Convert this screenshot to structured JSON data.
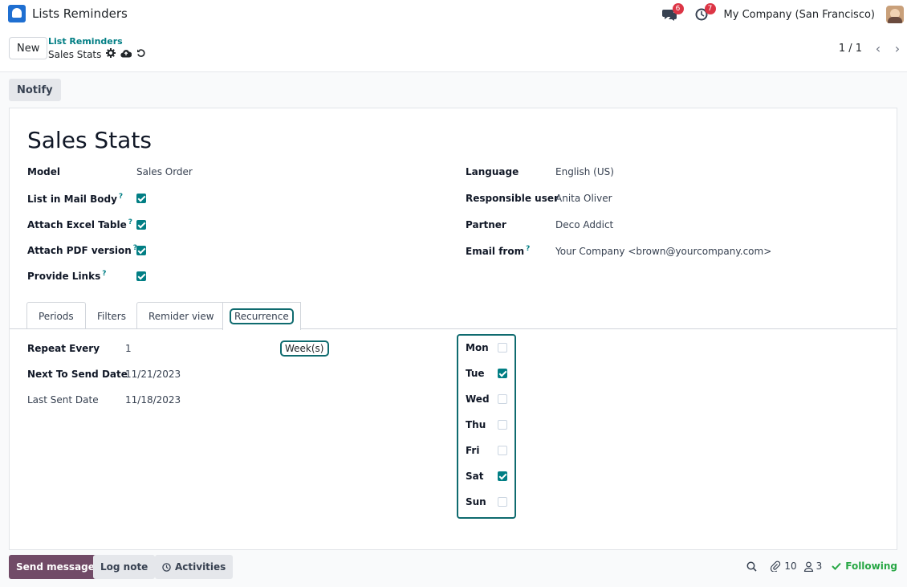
{
  "navbar": {
    "app_title": "Lists Reminders",
    "messages_badge": "6",
    "activities_badge": "7",
    "company": "My Company (San Francisco)"
  },
  "control": {
    "new_label": "New",
    "breadcrumb_parent": "List Reminders",
    "breadcrumb_current": "Sales Stats",
    "pager": "1 / 1"
  },
  "actions": {
    "notify_label": "Notify"
  },
  "record": {
    "title": "Sales Stats",
    "left_fields": [
      {
        "label": "Model",
        "value": "Sales Order"
      },
      {
        "label": "List in Mail Body",
        "help": "?",
        "checked": true
      },
      {
        "label": "Attach Excel Table",
        "help": "?",
        "checked": true
      },
      {
        "label": "Attach PDF version",
        "help": "?",
        "checked": true
      },
      {
        "label": "Provide Links",
        "help": "?",
        "checked": true
      }
    ],
    "right_fields": [
      {
        "label": "Language",
        "value": "English (US)"
      },
      {
        "label": "Responsible user",
        "value": "Anita Oliver"
      },
      {
        "label": "Partner",
        "value": "Deco Addict"
      },
      {
        "label": "Email from",
        "help": "?",
        "value": "Your Company <brown@yourcompany.com>"
      }
    ]
  },
  "tabs": [
    "Periods",
    "Filters",
    "Remider view",
    "Recurrence"
  ],
  "recurrence": {
    "repeat_label": "Repeat Every",
    "repeat_value": "1",
    "repeat_unit": "Week(s)",
    "next_label": "Next To Send Date",
    "next_value": "11/21/2023",
    "last_label": "Last Sent Date",
    "last_value": "11/18/2023",
    "days": [
      {
        "label": "Mon",
        "checked": false
      },
      {
        "label": "Tue",
        "checked": true
      },
      {
        "label": "Wed",
        "checked": false
      },
      {
        "label": "Thu",
        "checked": false
      },
      {
        "label": "Fri",
        "checked": false
      },
      {
        "label": "Sat",
        "checked": true
      },
      {
        "label": "Sun",
        "checked": false
      }
    ]
  },
  "chatter": {
    "send_label": "Send message",
    "log_label": "Log note",
    "activities_label": "Activities",
    "attachments_count": "10",
    "followers_count": "3",
    "following_label": "Following"
  },
  "colors": {
    "accent": "#017e84",
    "primary": "#714b67",
    "badge": "#dc3545",
    "highlight": "#0f6b6f"
  }
}
